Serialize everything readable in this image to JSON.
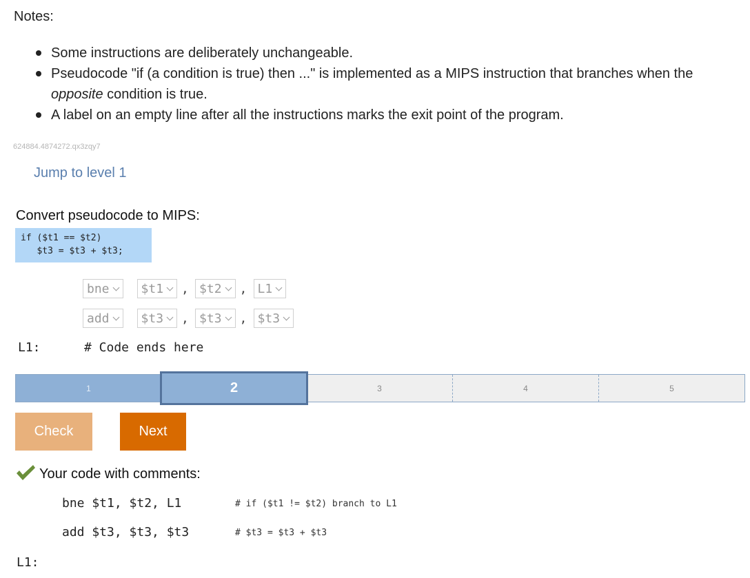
{
  "notes": {
    "title": "Notes:",
    "items": [
      {
        "text": "Some instructions are deliberately unchangeable."
      },
      {
        "text_a": "Pseudocode \"if (a condition is true) then ...\" is implemented as a MIPS instruction that branches when the ",
        "text_em": "opposite",
        "text_b": " condition is true."
      },
      {
        "text": "A label on an empty line after all the instructions marks the exit point of the program."
      }
    ]
  },
  "activity_id": "624884.4874272.qx3zqy7",
  "jump_link": "Jump to level 1",
  "convert": {
    "title": "Convert pseudocode to MIPS:",
    "pseudocode_line1": "if ($t1 == $t2)",
    "pseudocode_line2": "   $t3 = $t3 + $t3;"
  },
  "editor": {
    "row1": {
      "op": "bne",
      "arg1": "$t1",
      "arg2": "$t2",
      "arg3": "L1"
    },
    "row2": {
      "op": "add",
      "arg1": "$t3",
      "arg2": "$t3",
      "arg3": "$t3"
    },
    "comma": ",",
    "label": "L1:",
    "end_comment": "# Code ends here"
  },
  "progress": {
    "levels": [
      "1",
      "2",
      "3",
      "4",
      "5"
    ],
    "current": 2
  },
  "buttons": {
    "check": "Check",
    "next": "Next"
  },
  "result": {
    "title": "Your code with comments:",
    "line1_code": "bne $t1, $t2, L1",
    "line1_comment": "# if ($t1 != $t2) branch to L1",
    "line2_code": "add $t3, $t3, $t3",
    "line2_comment": "# $t3 = $t3 + $t3",
    "label": "L1:"
  },
  "colors": {
    "accent_blue": "#8eb0d6",
    "next_orange": "#d86a00",
    "check_orange": "#e8b17c",
    "pseudo_bg": "#b3d7f7",
    "success_green": "#6a8f3a"
  }
}
